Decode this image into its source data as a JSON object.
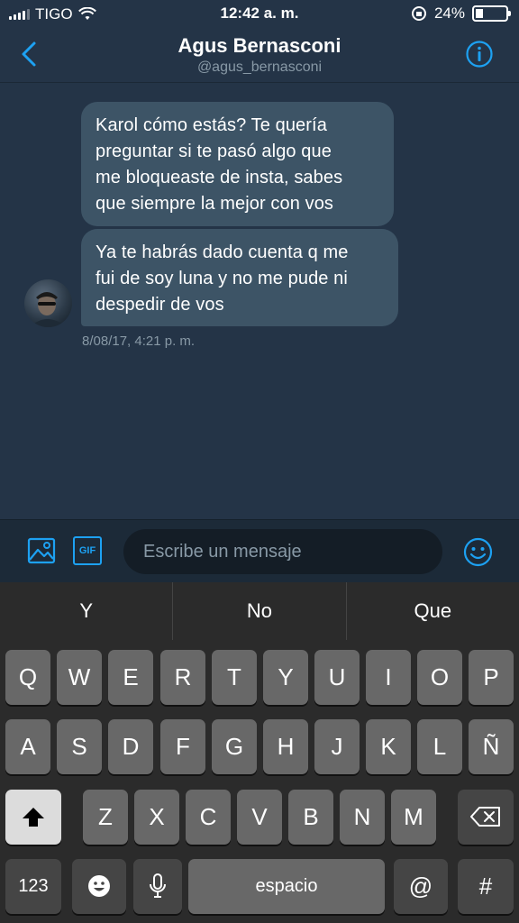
{
  "status_bar": {
    "carrier": "TIGO",
    "time": "12:42 a. m.",
    "battery": "24%",
    "battery_level": 0.24
  },
  "header": {
    "title": "Agus Bernasconi",
    "handle": "@agus_bernasconi"
  },
  "messages": [
    {
      "lines": [
        "Karol cómo estás? Te quería",
        "preguntar si te pasó algo que",
        "me bloqueaste de insta, sabes",
        "que siempre la mejor con vos"
      ]
    },
    {
      "lines": [
        "Ya te habrás dado cuenta q me",
        "fui de soy luna y no me pude ni",
        "despedir de vos"
      ]
    }
  ],
  "timestamp": "8/08/17, 4:21 p. m.",
  "compose": {
    "placeholder": "Escribe un mensaje",
    "gif_label": "GIF"
  },
  "predictions": [
    "Y",
    "No",
    "Que"
  ],
  "keyboard": {
    "row1": [
      "Q",
      "W",
      "E",
      "R",
      "T",
      "Y",
      "U",
      "I",
      "O",
      "P"
    ],
    "row2": [
      "A",
      "S",
      "D",
      "F",
      "G",
      "H",
      "J",
      "K",
      "L",
      "Ñ"
    ],
    "row3": [
      "Z",
      "X",
      "C",
      "V",
      "B",
      "N",
      "M"
    ],
    "numbers": "123",
    "space": "espacio",
    "at": "@",
    "hash": "#"
  },
  "colors": {
    "background": "#243447",
    "accent": "#1da1f2",
    "bubble": "#3d5466",
    "muted": "#8899a6"
  },
  "icons": {
    "back": "chevron-left-icon",
    "info": "info-icon",
    "image": "image-icon",
    "gif": "gif-icon",
    "emoji": "emoji-icon",
    "shift": "shift-icon",
    "backspace": "backspace-icon",
    "mic": "microphone-icon"
  }
}
